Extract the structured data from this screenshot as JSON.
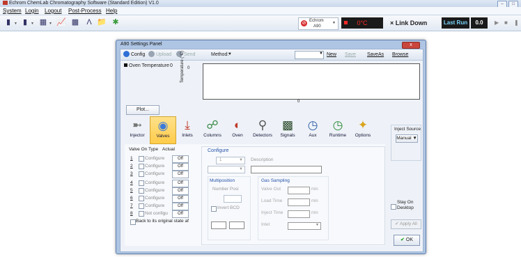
{
  "app": {
    "title": "Echrom ChemLab Chromatography Software (Standard Edition) V1.0",
    "window_controls": [
      "–",
      "□"
    ]
  },
  "menu": [
    "System",
    "Login",
    "Logout",
    "Post-Process",
    "Help"
  ],
  "toolbar": {
    "instrument_name": "Echrom",
    "instrument_model": "A90",
    "temperature": "0°C",
    "link_status": "× Link Down",
    "last_run_label": "Last Run",
    "last_run_value": "0.0"
  },
  "dialog": {
    "title": "A90 Settings Panel",
    "close_label": "x",
    "tabs": [
      {
        "label": "Config",
        "icon": "info-icon"
      },
      {
        "label": "Upload",
        "icon": "upload-icon"
      },
      {
        "label": "Send",
        "icon": "send-icon"
      }
    ],
    "method_label": "Method:",
    "method_value": "",
    "actions": {
      "new": "New",
      "save": "Save",
      "save_as": "SaveAs",
      "browse": "Browse"
    },
    "oven": {
      "label": "Oven Temperature",
      "range_min": "0",
      "y_axis_label": "Temperature (°C)",
      "y_value": "0",
      "x_value": "0"
    },
    "plot_button": "Plot...",
    "categories": [
      "Injector",
      "Valves",
      "Inlets",
      "Columns",
      "Oven",
      "Detectors",
      "Signals",
      "Aux",
      "Runtime",
      "Options"
    ],
    "active_category": "Valves",
    "inject_source": {
      "title": "Inject Source",
      "value": "Manual"
    },
    "valves": {
      "headers": {
        "valve_on": "Valve On",
        "type": "Type",
        "actual": "Actual"
      },
      "rows": [
        {
          "num": "1",
          "type": "Configure",
          "actual": "Off"
        },
        {
          "num": "2",
          "type": "Configure",
          "actual": "Off"
        },
        {
          "num": "3",
          "type": "Configure",
          "actual": "Off"
        },
        {
          "num": "4",
          "type": "Configure",
          "actual": "Off"
        },
        {
          "num": "5",
          "type": "Configure",
          "actual": "Off"
        },
        {
          "num": "6",
          "type": "Configure",
          "actual": "Off"
        },
        {
          "num": "7",
          "type": "Configure",
          "actual": "Off"
        },
        {
          "num": "8",
          "type": "Not configu",
          "actual": "Off"
        }
      ],
      "back_label": "Back to its original state af"
    },
    "configure": {
      "title": "Configure",
      "valve_value": "1",
      "description_label": "Description",
      "multiposition": {
        "title": "Multiposition",
        "number_label": "Number Posi",
        "bcd_label": "Invert BCD"
      },
      "gas_sampling": {
        "title": "Gas Sampling",
        "rows": [
          {
            "label": "Valve Out",
            "unit": "min"
          },
          {
            "label": "Load Time",
            "unit": "min"
          },
          {
            "label": "Inject Time",
            "unit": "min"
          },
          {
            "label": "Inlet",
            "unit": ""
          }
        ]
      }
    },
    "stay_on_desktop": "Stay On Desktop",
    "apply_button": "Apply All",
    "ok_button": "OK"
  }
}
